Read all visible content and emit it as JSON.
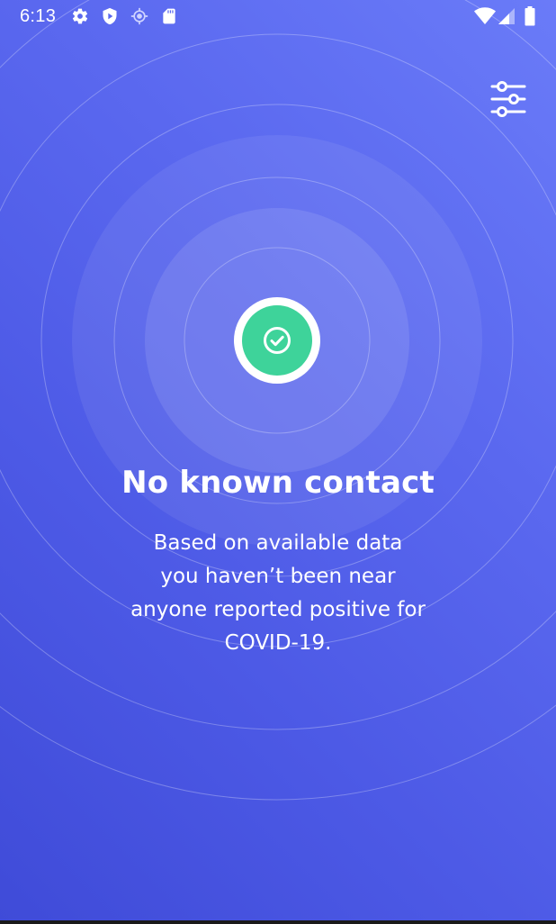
{
  "status_bar": {
    "time": "6:13",
    "left_icons": [
      "gear-icon",
      "shield-icon",
      "location-icon",
      "sd-card-icon"
    ],
    "right_icons": [
      "wifi-icon",
      "cell-signal-icon",
      "battery-icon"
    ]
  },
  "toolbar": {
    "filter_icon": "sliders-icon"
  },
  "status": {
    "icon": "check-circle-icon",
    "accent_color": "#3ed39a",
    "title": "No known contact",
    "description_lines": [
      "Based on available data",
      "you haven’t been near",
      "anyone reported positive for",
      "COVID-19."
    ]
  },
  "colors": {
    "background_top": "#6a7bf8",
    "background_bottom": "#3f4bd8"
  }
}
